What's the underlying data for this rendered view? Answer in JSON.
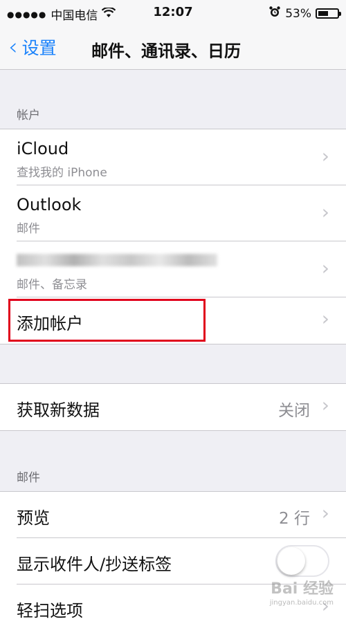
{
  "status_bar": {
    "signal_dots": "●●●●●",
    "carrier": "中国电信",
    "wifi_icon": "wifi-icon",
    "time": "12:07",
    "alarm_icon": "alarm-icon",
    "battery_percent": "53%",
    "battery_level": 0.53
  },
  "nav": {
    "back_label": "设置",
    "title": "邮件、通讯录、日历"
  },
  "accounts_section": {
    "header": "帐户",
    "rows": [
      {
        "title": "iCloud",
        "subtitle": "查找我的 iPhone"
      },
      {
        "title": "Outlook",
        "subtitle": "邮件"
      },
      {
        "title": "",
        "subtitle": "邮件、备忘录"
      },
      {
        "title": "添加帐户"
      }
    ]
  },
  "fetch": {
    "title": "获取新数据",
    "value": "关闭"
  },
  "mail_section": {
    "header": "邮件",
    "rows": [
      {
        "title": "预览",
        "value": "2 行"
      },
      {
        "title": "显示收件人/抄送标签",
        "toggle_on": false
      },
      {
        "title": "轻扫选项"
      }
    ]
  },
  "watermark": {
    "text": "Bai 经验",
    "url": "jingyan.baidu.com"
  },
  "colors": {
    "accent": "#1a82fb",
    "highlight": "#e0001b"
  }
}
